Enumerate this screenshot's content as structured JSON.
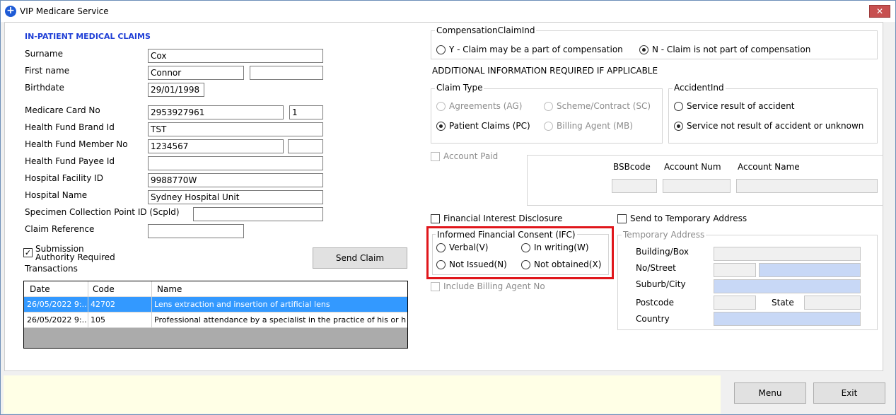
{
  "window": {
    "title": "VIP Medicare Service",
    "close": "✕"
  },
  "left": {
    "heading": "IN-PATIENT MEDICAL CLAIMS",
    "labels": {
      "surname": "Surname",
      "first_name": "First name",
      "birthdate": "Birthdate",
      "medicare_card_no": "Medicare Card No",
      "health_fund_brand_id": "Health Fund Brand Id",
      "health_fund_member_no": "Health Fund Member No",
      "health_fund_payee_id": "Health Fund Payee Id",
      "hospital_facility_id": "Hospital Facility ID",
      "hospital_name": "Hospital Name",
      "scpid": "Specimen Collection Point ID (Scpld)",
      "claim_reference": "Claim Reference"
    },
    "values": {
      "surname": "Cox",
      "first_name": "Connor",
      "first_name_2": "",
      "birthdate": "29/01/1998",
      "medicare_card_no": "2953927961",
      "medicare_irn": "1",
      "health_fund_brand_id": "TST",
      "health_fund_member_no": "1234567",
      "health_fund_member_2": "",
      "health_fund_payee_id": "",
      "hospital_facility_id": "9988770W",
      "hospital_name": "Sydney Hospital Unit",
      "scpid": "",
      "claim_reference": ""
    },
    "submission_line1": "Submission",
    "submission_line2": "Authority Required",
    "submission_checked": "✓",
    "send_claim": "Send Claim",
    "transactions_label": "Transactions",
    "grid": {
      "columns": [
        "Date",
        "Code",
        "Name"
      ],
      "rows": [
        {
          "date": "26/05/2022 9:...",
          "code": "42702",
          "name": "Lens extraction and insertion of artificial lens"
        },
        {
          "date": "26/05/2022 9:...",
          "code": "105",
          "name": "Professional attendance by a specialist in the practice of his or her speci..."
        }
      ]
    }
  },
  "right": {
    "compensation": {
      "title": "CompensationClaimInd",
      "y": "Y - Claim may be a part of compensation",
      "n": "N - Claim is not part of compensation"
    },
    "additional_info": "ADDITIONAL INFORMATION REQUIRED IF APPLICABLE",
    "claim_type": {
      "title": "Claim Type",
      "ag": "Agreements (AG)",
      "sc": "Scheme/Contract (SC)",
      "pc": "Patient Claims (PC)",
      "mb": "Billing Agent (MB)"
    },
    "accident": {
      "title": "AccidentInd",
      "yes": "Service result of accident",
      "no": "Service not result of accident or unknown"
    },
    "account_paid": "Account Paid",
    "bank": {
      "bsb": "BSBcode",
      "num": "Account Num",
      "name": "Account Name"
    },
    "financial_interest": "Financial Interest Disclosure",
    "send_temp": "Send to Temporary Address",
    "ifc": {
      "title": "Informed Financial Consent (IFC)",
      "verbal": "Verbal(V)",
      "writing": "In writing(W)",
      "not_issued": "Not Issued(N)",
      "not_obtained": "Not obtained(X)"
    },
    "include_billing": "Include Billing Agent No",
    "temp_address": {
      "title": "Temporary Address",
      "building": "Building/Box",
      "street": "No/Street",
      "suburb": "Suburb/City",
      "postcode": "Postcode",
      "state": "State",
      "country": "Country"
    }
  },
  "footer": {
    "menu": "Menu",
    "exit": "Exit"
  },
  "colors": {
    "heading": "#1f3fd6",
    "selected_row": "#3399ff",
    "highlight_box": "#e0161b",
    "footer": "#ffffe6"
  }
}
